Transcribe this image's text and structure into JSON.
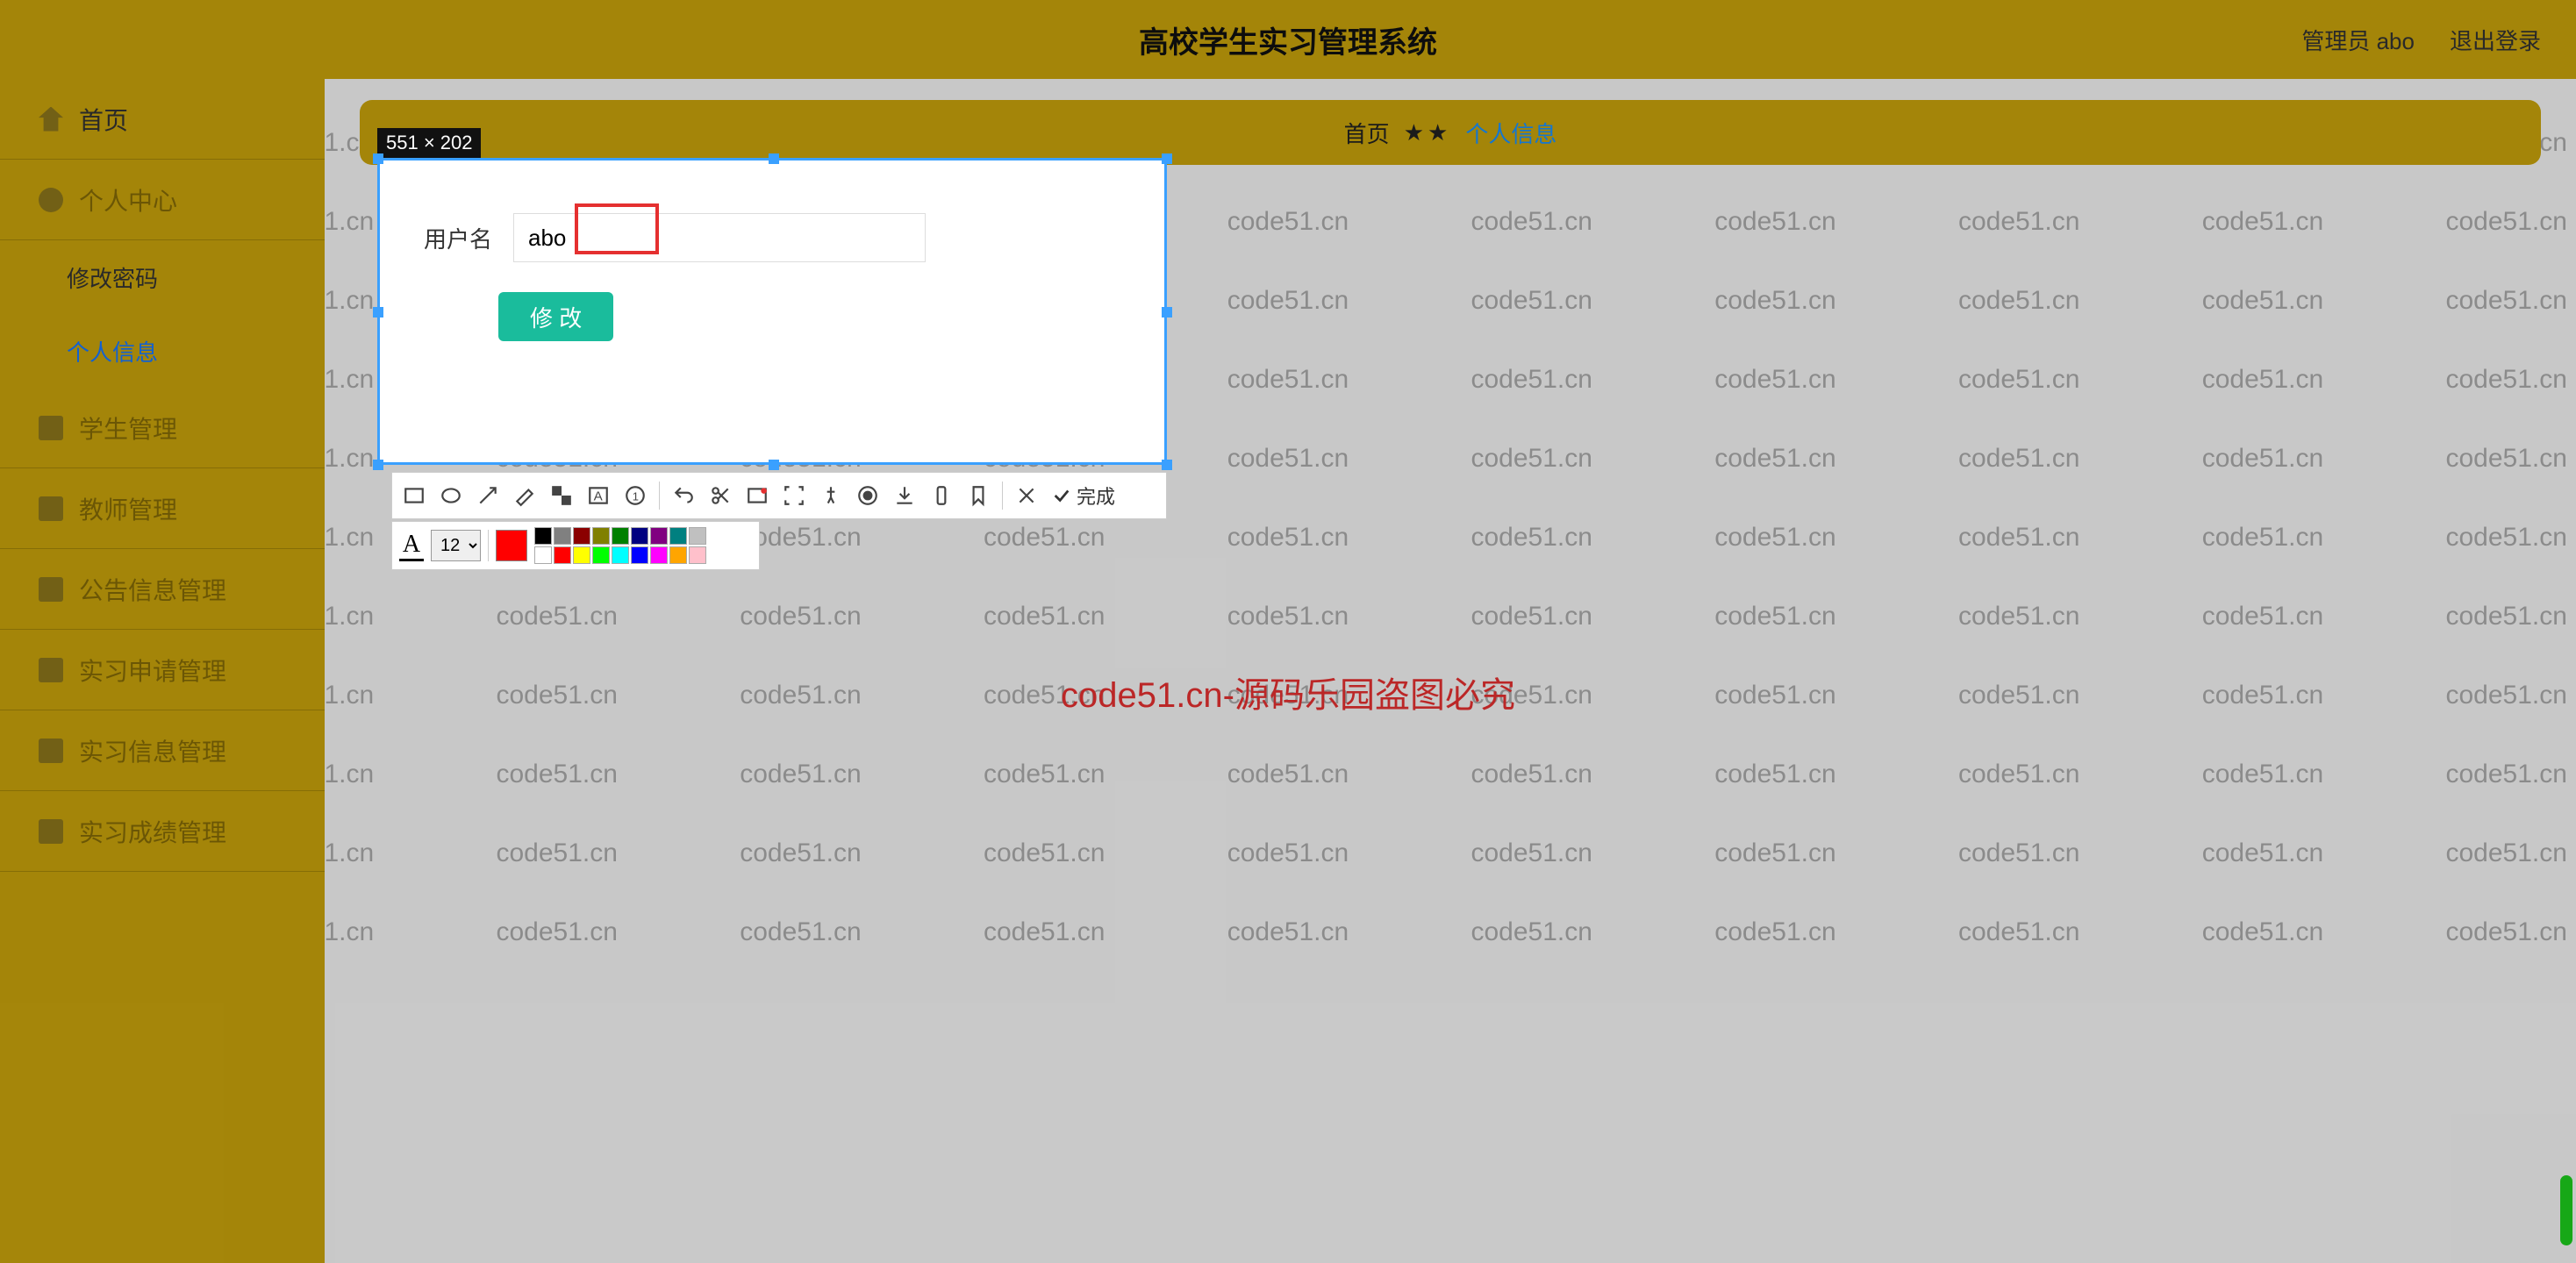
{
  "watermark_text": "code51.cn",
  "watermark_center": "code51.cn-源码乐园盗图必究",
  "header": {
    "title": "高校学生实习管理系统",
    "admin_label": "管理员 abo",
    "logout": "退出登录"
  },
  "sidebar": {
    "items": [
      {
        "label": "首页",
        "icon": "home"
      },
      {
        "label": "个人中心",
        "icon": "user"
      },
      {
        "label": "学生管理",
        "icon": "box"
      },
      {
        "label": "教师管理",
        "icon": "box"
      },
      {
        "label": "公告信息管理",
        "icon": "box"
      },
      {
        "label": "实习申请管理",
        "icon": "box"
      },
      {
        "label": "实习信息管理",
        "icon": "box"
      },
      {
        "label": "实习成绩管理",
        "icon": "box"
      }
    ],
    "subitems": [
      {
        "label": "修改密码"
      },
      {
        "label": "个人信息"
      }
    ]
  },
  "breadcrumb": {
    "home": "首页",
    "stars": "★★",
    "current": "个人信息"
  },
  "selection": {
    "dim_label": "551 × 202"
  },
  "form": {
    "username_label": "用户名",
    "username_value": "abo",
    "submit": "修 改"
  },
  "fontbar": {
    "letter": "A",
    "size": "12"
  },
  "toolbar_done": "完成",
  "colors_row1": [
    "#000000",
    "#808080",
    "#8b0000",
    "#808000",
    "#008000",
    "#000080",
    "#800080",
    "#008080",
    "#c0c0c0"
  ],
  "colors_row2": [
    "#ffffff",
    "#ff0000",
    "#ffff00",
    "#00ff00",
    "#00ffff",
    "#0000ff",
    "#ff00ff",
    "#ffa500",
    "#ffc0cb"
  ]
}
